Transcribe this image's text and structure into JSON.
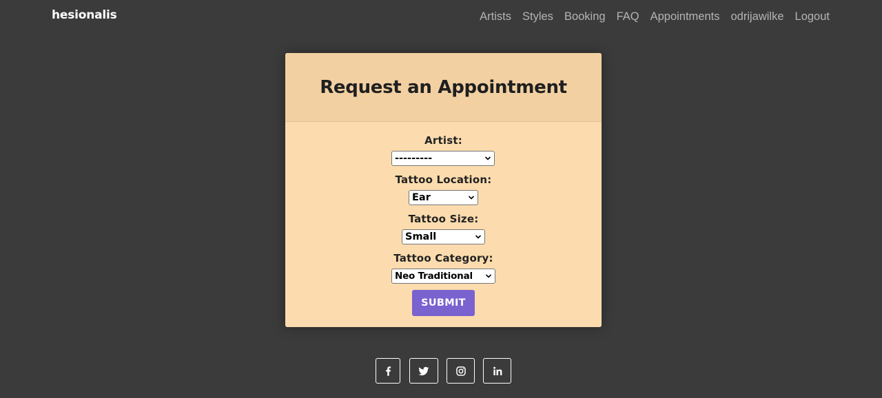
{
  "navbar": {
    "brand": "hesionalis",
    "links": [
      "Artists",
      "Styles",
      "Booking",
      "FAQ",
      "Appointments",
      "odrijawilke",
      "Logout"
    ]
  },
  "form": {
    "title": "Request an Appointment",
    "fields": [
      {
        "label": "Artist:",
        "value": "---------"
      },
      {
        "label": "Tattoo Location:",
        "value": "Ear"
      },
      {
        "label": "Tattoo Size:",
        "value": "Small"
      },
      {
        "label": "Tattoo Category:",
        "value": "Neo Traditional"
      }
    ],
    "submit_label": "SUBMIT"
  },
  "footer": {
    "social_icons": [
      "facebook-icon",
      "twitter-icon",
      "instagram-icon",
      "linkedin-icon"
    ]
  },
  "colors": {
    "background": "#3b3b3b",
    "card": "#fcdcae",
    "card_header": "#f2d0a2",
    "button": "#7a62cf",
    "nav_link": "#b4b4b4"
  }
}
